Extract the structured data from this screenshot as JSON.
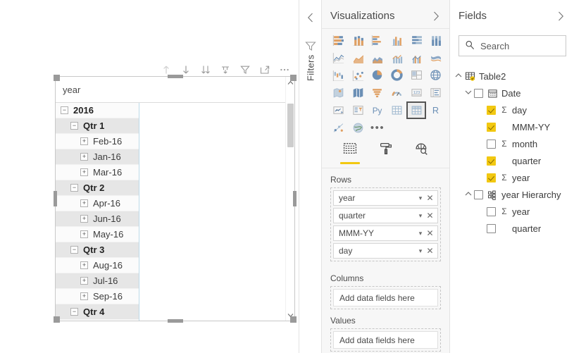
{
  "visual_header": {
    "buttons": [
      {
        "name": "drill-up-icon",
        "title": "Drill up",
        "disabled": true
      },
      {
        "name": "drill-down-icon",
        "title": "Drill down",
        "disabled": false
      },
      {
        "name": "expand-all-icon",
        "title": "Expand all down one level",
        "disabled": false
      },
      {
        "name": "drill-mode-icon",
        "title": "Go to next level",
        "disabled": false
      },
      {
        "name": "filter-icon",
        "title": "Filters",
        "disabled": false
      },
      {
        "name": "focus-mode-icon",
        "title": "Focus mode",
        "disabled": false
      },
      {
        "name": "more-options-icon",
        "title": "More options",
        "disabled": false
      }
    ]
  },
  "matrix": {
    "column_header": "year",
    "rows": [
      {
        "label": "2016",
        "level": 0,
        "toggle": "minus",
        "bold": true,
        "band": false
      },
      {
        "label": "Qtr 1",
        "level": 1,
        "toggle": "minus",
        "bold": true,
        "band": true
      },
      {
        "label": "Feb-16",
        "level": 2,
        "toggle": "plus",
        "bold": false,
        "band": false
      },
      {
        "label": "Jan-16",
        "level": 2,
        "toggle": "plus",
        "bold": false,
        "band": true
      },
      {
        "label": "Mar-16",
        "level": 2,
        "toggle": "plus",
        "bold": false,
        "band": false
      },
      {
        "label": "Qtr 2",
        "level": 1,
        "toggle": "minus",
        "bold": true,
        "band": true
      },
      {
        "label": "Apr-16",
        "level": 2,
        "toggle": "plus",
        "bold": false,
        "band": false
      },
      {
        "label": "Jun-16",
        "level": 2,
        "toggle": "plus",
        "bold": false,
        "band": true
      },
      {
        "label": "May-16",
        "level": 2,
        "toggle": "plus",
        "bold": false,
        "band": false
      },
      {
        "label": "Qtr 3",
        "level": 1,
        "toggle": "minus",
        "bold": true,
        "band": true
      },
      {
        "label": "Aug-16",
        "level": 2,
        "toggle": "plus",
        "bold": false,
        "band": false
      },
      {
        "label": "Jul-16",
        "level": 2,
        "toggle": "plus",
        "bold": false,
        "band": true
      },
      {
        "label": "Sep-16",
        "level": 2,
        "toggle": "plus",
        "bold": false,
        "band": false
      },
      {
        "label": "Qtr 4",
        "level": 1,
        "toggle": "minus",
        "bold": true,
        "band": true
      }
    ]
  },
  "filters_pane": {
    "label": "Filters",
    "collapse_icon": "chevron-left-icon",
    "funnel_icon": "filter-funnel-icon"
  },
  "visualizations": {
    "title": "Visualizations",
    "expand_icon": "chevron-right-icon",
    "gallery": [
      "stacked-bar-chart-icon",
      "stacked-column-chart-icon",
      "clustered-bar-chart-icon",
      "clustered-column-chart-icon",
      "hundred-percent-stacked-bar-chart-icon",
      "hundred-percent-stacked-column-chart-icon",
      "line-chart-icon",
      "area-chart-icon",
      "stacked-area-chart-icon",
      "line-and-stacked-column-chart-icon",
      "line-and-clustered-column-chart-icon",
      "ribbon-chart-icon",
      "waterfall-chart-icon",
      "scatter-chart-icon",
      "pie-chart-icon",
      "donut-chart-icon",
      "treemap-icon",
      "map-icon",
      "filled-map-icon",
      "shape-map-icon",
      "funnel-chart-icon",
      "gauge-chart-icon",
      "card-icon",
      "multi-row-card-icon",
      "kpi-icon",
      "slicer-icon",
      "python-visual-icon",
      "table-icon",
      "matrix-icon",
      "r-script-visual-icon",
      "arcgis-maps-icon",
      "get-more-visuals-icon",
      "more-options-icon"
    ],
    "selected_gallery_index": 28,
    "tabs": [
      {
        "name": "fields-tab",
        "icon": "fields-pane-icon",
        "active": true
      },
      {
        "name": "format-tab",
        "icon": "paint-roller-icon",
        "active": false
      },
      {
        "name": "analytics-tab",
        "icon": "magnifying-glass-icon",
        "active": false
      }
    ],
    "wells": [
      {
        "label": "Rows",
        "chips": [
          "year",
          "quarter",
          "MMM-YY",
          "day"
        ],
        "placeholder": null
      },
      {
        "label": "Columns",
        "chips": [],
        "placeholder": "Add data fields here"
      },
      {
        "label": "Values",
        "chips": [],
        "placeholder": "Add data fields here"
      }
    ],
    "chip_dropdown_icon": "chevron-down-icon",
    "chip_remove_icon": "close-icon"
  },
  "fields": {
    "title": "Fields",
    "expand_icon": "chevron-right-icon",
    "search_placeholder": "Search",
    "search_icon": "search-icon",
    "tree": [
      {
        "name": "Table2",
        "indent": 0,
        "arrow": "up",
        "checkbox": null,
        "sigma": false,
        "icon": "table-checked-icon"
      },
      {
        "name": "Date",
        "indent": 1,
        "arrow": "down",
        "checkbox": false,
        "sigma": false,
        "icon": "calendar-icon"
      },
      {
        "name": "day",
        "indent": 2,
        "arrow": null,
        "checkbox": true,
        "sigma": true,
        "icon": null
      },
      {
        "name": "MMM-YY",
        "indent": 2,
        "arrow": null,
        "checkbox": true,
        "sigma": false,
        "icon": null
      },
      {
        "name": "month",
        "indent": 2,
        "arrow": null,
        "checkbox": false,
        "sigma": true,
        "icon": null
      },
      {
        "name": "quarter",
        "indent": 2,
        "arrow": null,
        "checkbox": true,
        "sigma": false,
        "icon": null
      },
      {
        "name": "year",
        "indent": 2,
        "arrow": null,
        "checkbox": true,
        "sigma": true,
        "icon": null
      },
      {
        "name": "year Hierarchy",
        "indent": 1,
        "arrow": "up",
        "checkbox": false,
        "sigma": false,
        "icon": "hierarchy-icon"
      },
      {
        "name": "year",
        "indent": 2,
        "arrow": null,
        "checkbox": false,
        "sigma": true,
        "icon": null
      },
      {
        "name": "quarter",
        "indent": 2,
        "arrow": null,
        "checkbox": false,
        "sigma": false,
        "icon": null
      }
    ]
  },
  "colors": {
    "accent_yellow": "#f2c811",
    "pane_bg": "#f7f7f7",
    "row_band": "#e6e6e6",
    "matrix_grid": "#bcd9e8"
  }
}
